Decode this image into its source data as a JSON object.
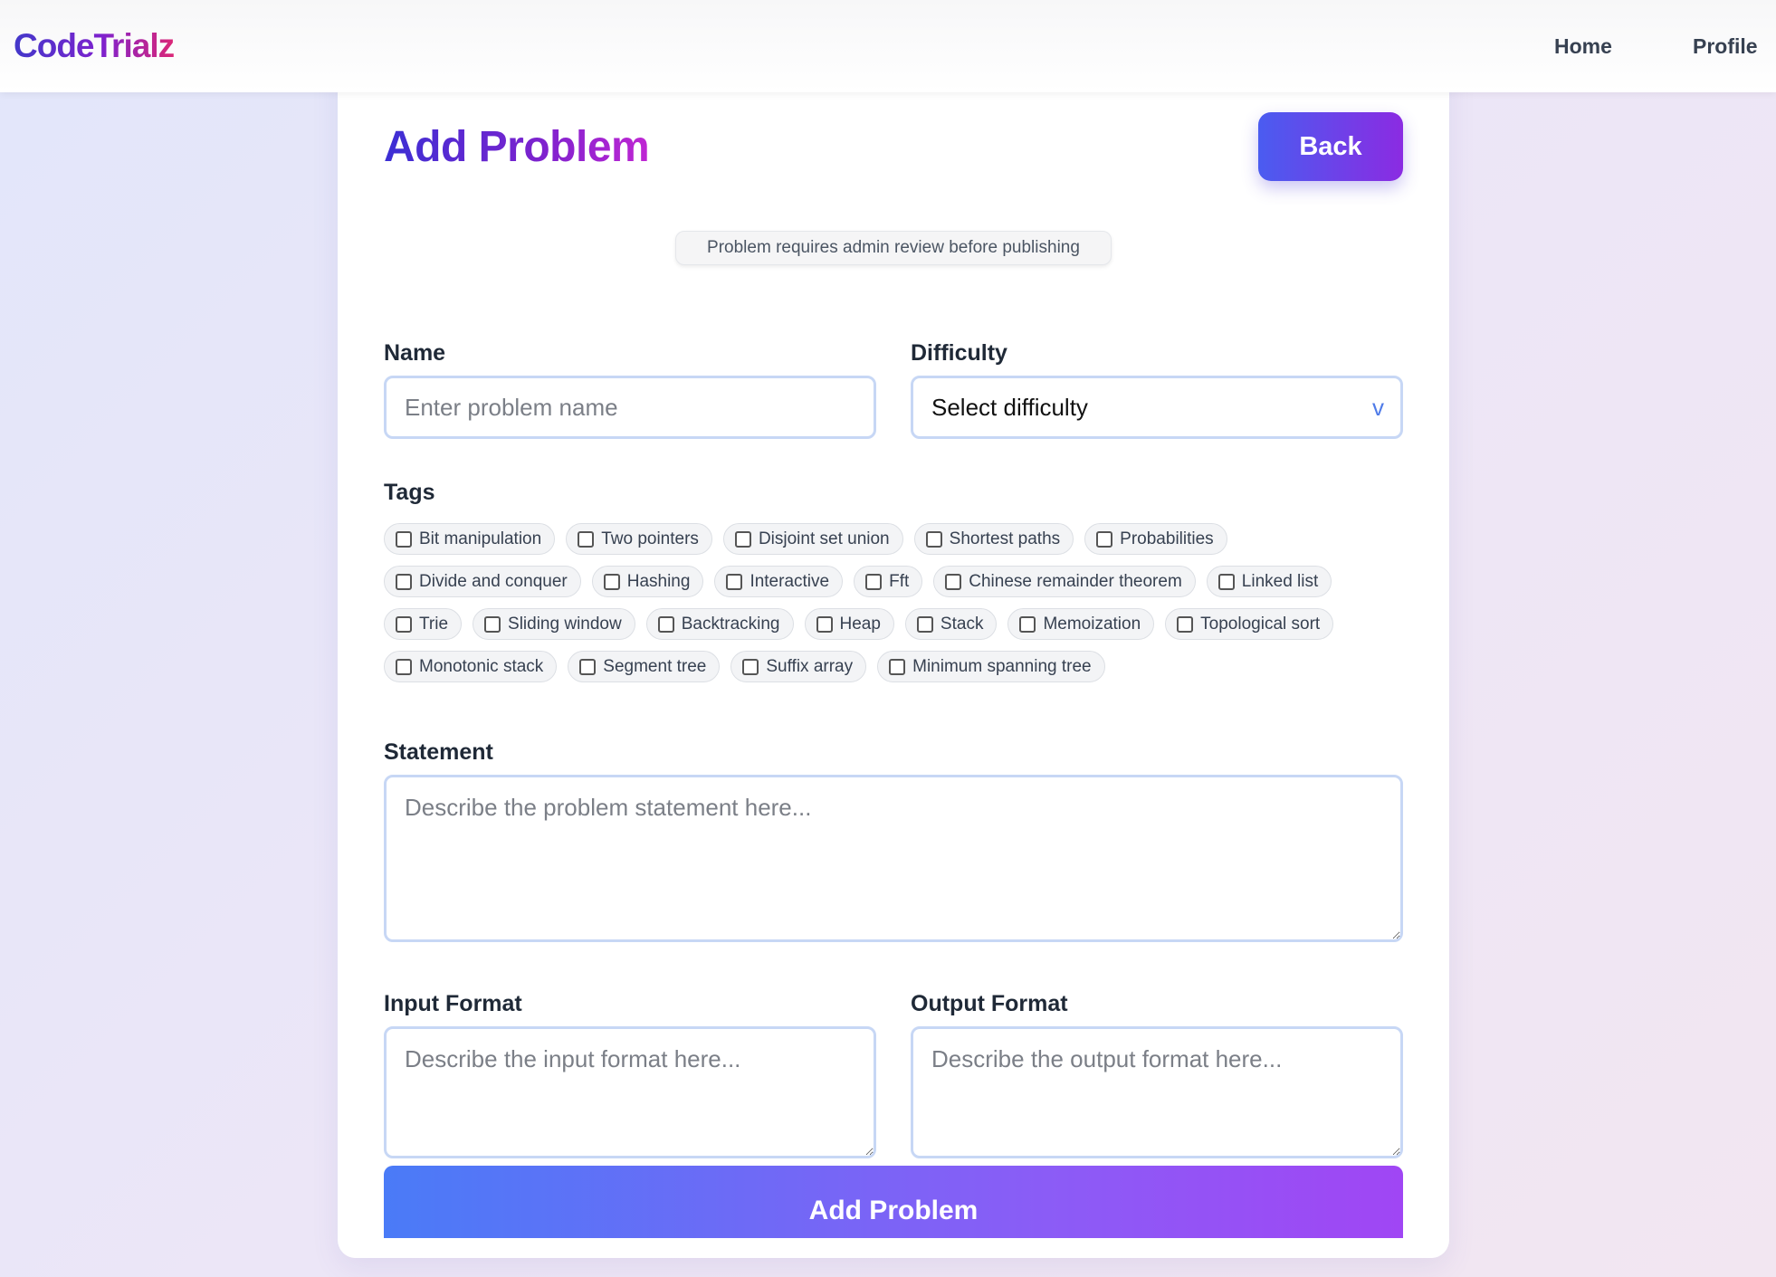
{
  "nav": {
    "logo": "CodeTrialz",
    "links": [
      "Home",
      "Profile"
    ]
  },
  "form": {
    "title": "Add Problem",
    "back_label": "Back",
    "notice": "Problem requires admin review before publishing",
    "name": {
      "label": "Name",
      "placeholder": "Enter problem name",
      "value": ""
    },
    "difficulty": {
      "label": "Difficulty",
      "selected": "Select difficulty",
      "chevron": "v"
    },
    "tags": {
      "label": "Tags",
      "rows": [
        [
          "Bit manipulation",
          "Two pointers",
          "Disjoint set union",
          "Shortest paths",
          "Probabilities"
        ],
        [
          "Divide and conquer",
          "Hashing",
          "Interactive",
          "Fft",
          "Chinese remainder theorem",
          "Linked list"
        ],
        [
          "Trie",
          "Sliding window",
          "Backtracking",
          "Heap",
          "Stack",
          "Memoization",
          "Topological sort"
        ],
        [
          "Monotonic stack",
          "Segment tree",
          "Suffix array",
          "Minimum spanning tree"
        ]
      ]
    },
    "statement": {
      "label": "Statement",
      "placeholder": "Describe the problem statement here..."
    },
    "input_format": {
      "label": "Input Format",
      "placeholder": "Describe the input format here..."
    },
    "output_format": {
      "label": "Output Format",
      "placeholder": "Describe the output format here..."
    },
    "submit_label": "Add Problem"
  }
}
